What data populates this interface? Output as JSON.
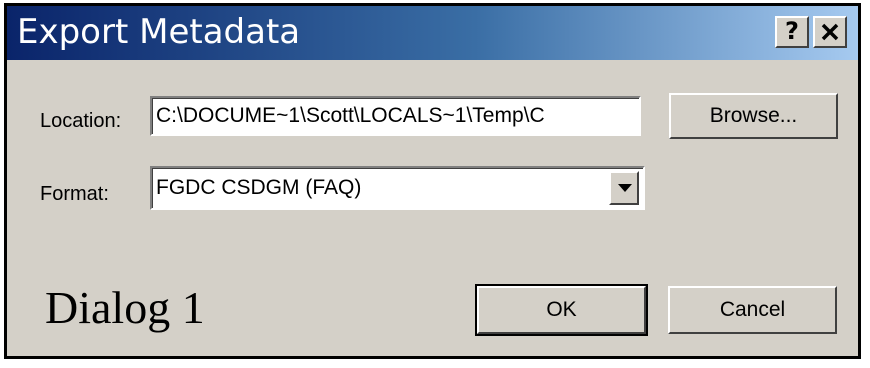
{
  "window": {
    "title": "Export Metadata",
    "help_label": "?",
    "close_label": "✕"
  },
  "location": {
    "label": "Location:",
    "value": "C:\\DOCUME~1\\Scott\\LOCALS~1\\Temp\\C"
  },
  "format": {
    "label": "Format:",
    "selected": "FGDC CSDGM (FAQ)"
  },
  "buttons": {
    "browse": "Browse...",
    "ok": "OK",
    "cancel": "Cancel"
  },
  "caption": "Dialog 1"
}
